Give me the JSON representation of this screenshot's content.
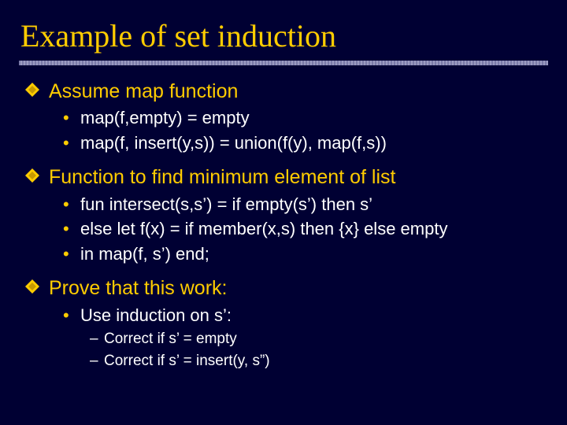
{
  "title": "Example of set induction",
  "sections": [
    {
      "heading": "Assume map function",
      "items": [
        {
          "text": "map(f,empty) = empty"
        },
        {
          "text": "map(f, insert(y,s)) = union(f(y), map(f,s))"
        }
      ]
    },
    {
      "heading": "Function to find minimum element of list",
      "items": [
        {
          "text": "fun intersect(s,s’) =  if empty(s’) then s’"
        },
        {
          "text": "else let f(x) = if member(x,s) then {x} else empty"
        },
        {
          "text": "in map(f, s’)  end;"
        }
      ]
    },
    {
      "heading": "Prove that this work:",
      "items": [
        {
          "text": "Use induction on s’:",
          "sub": [
            "Correct if s’ = empty",
            "Correct if s’ = insert(y, s”)"
          ]
        }
      ]
    }
  ]
}
